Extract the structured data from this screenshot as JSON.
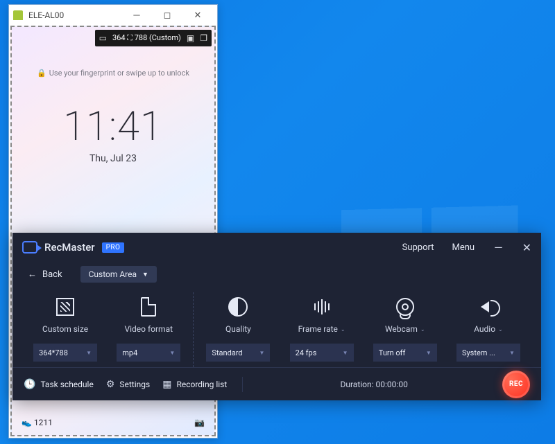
{
  "mirror": {
    "title": "ELE-AL00",
    "capture_bar": {
      "dims": "364 ⛶ 788  (Custom)"
    },
    "unlock_hint": "Use your fingerprint or swipe up to unlock",
    "clock": "11:41",
    "date": "Thu, Jul 23",
    "step_count": "1211"
  },
  "rec": {
    "title": "RecMaster",
    "badge": "PRO",
    "support": "Support",
    "menu": "Menu",
    "back": "Back",
    "mode": "Custom Area",
    "options": {
      "custom_size": {
        "label": "Custom size",
        "value": "364*788"
      },
      "video_format": {
        "label": "Video format",
        "value": "mp4"
      },
      "quality": {
        "label": "Quality",
        "value": "Standard"
      },
      "frame_rate": {
        "label": "Frame rate",
        "value": "24 fps"
      },
      "webcam": {
        "label": "Webcam",
        "value": "Turn off"
      },
      "audio": {
        "label": "Audio",
        "value": "System ..."
      }
    },
    "footer": {
      "task_schedule": "Task schedule",
      "settings": "Settings",
      "recording_list": "Recording list",
      "duration_label": "Duration:",
      "duration_value": "00:00:00",
      "rec_label": "REC"
    }
  }
}
